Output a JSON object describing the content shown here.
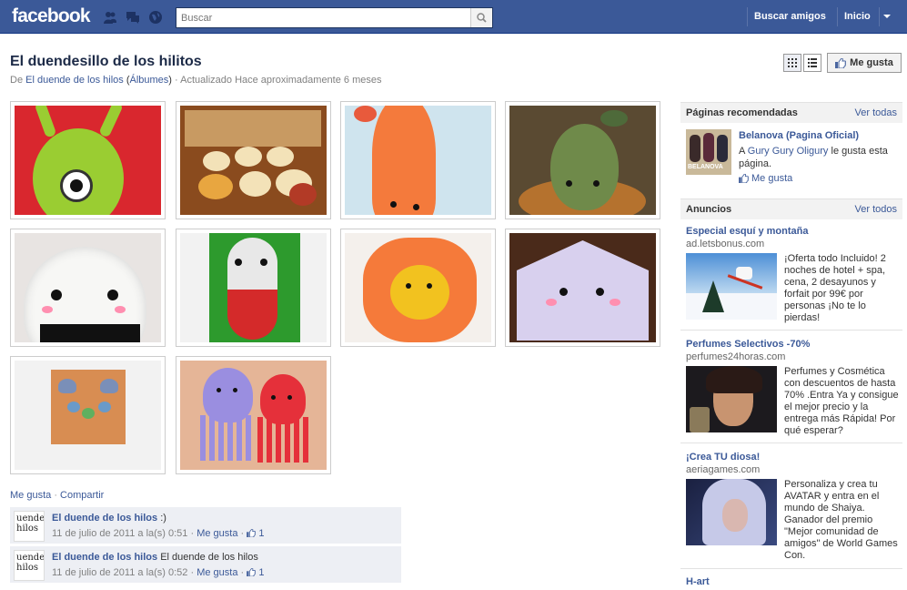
{
  "topbar": {
    "logo": "facebook",
    "search_placeholder": "Buscar",
    "find_friends": "Buscar amigos",
    "home": "Inicio"
  },
  "album": {
    "title": "El duendesillo de los hilitos",
    "meta_prefix": "De",
    "owner": "El duende de los hilos",
    "albums_open": "(",
    "albums_link": "Álbumes",
    "albums_close": ")",
    "updated": "· Actualizado Hace aproximadamente 6 meses",
    "like_button": "Me gusta"
  },
  "photos": [
    {
      "desc": "green alien amigurumi"
    },
    {
      "desc": "cookie amigurumis"
    },
    {
      "desc": "orange squid amigurumi"
    },
    {
      "desc": "green pear amigurumi"
    },
    {
      "desc": "white onigiri amigurumi"
    },
    {
      "desc": "red white capsule amigurumi"
    },
    {
      "desc": "orange flower amigurumi"
    },
    {
      "desc": "purple house amigurumi"
    },
    {
      "desc": "tiny slime figures"
    },
    {
      "desc": "purple and red octopus amigurumis"
    }
  ],
  "actions": {
    "like": "Me gusta",
    "dot": "·",
    "share": "Compartir"
  },
  "comments": [
    {
      "avatar_text": "uende\nhilos",
      "author": "El duende de los hilos",
      "text": ":)",
      "time": "11 de julio de 2011 a la(s) 0:51 ·",
      "like": "Me gusta",
      "dot": "·",
      "likes": "1"
    },
    {
      "avatar_text": "uende\nhilos",
      "author": "El duende de los hilos",
      "text": "El duende de los hilos",
      "time": "11 de julio de 2011 a la(s) 0:52 ·",
      "like": "Me gusta",
      "dot": "·",
      "likes": "1"
    }
  ],
  "sidebar": {
    "recommended": {
      "title": "Páginas recomendadas",
      "see_all": "Ver todas",
      "page_name": "Belanova (Pagina Oficial)",
      "line_prefix": "A",
      "friend": "Gury Gury Oligury",
      "line_suffix": "le gusta esta página.",
      "like": "Me gusta",
      "thumb_text": "BELANOVA"
    },
    "ads": {
      "title": "Anuncios",
      "see_all": "Ver todos",
      "items": [
        {
          "title": "Especial esquí y montaña",
          "domain": "ad.letsbonus.com",
          "text": "¡Oferta todo Incluido! 2 noches de hotel + spa, cena, 2 desayunos y forfait por 99€ por personas ¡No te lo pierdas!"
        },
        {
          "title": "Perfumes Selectivos -70%",
          "domain": "perfumes24horas.com",
          "text": "Perfumes y Cosmética con descuentos de hasta 70% .Entra Ya y consigue el mejor precio y la entrega más Rápida! Por qué esperar?"
        },
        {
          "title": "¡Crea TU diosa!",
          "domain": "aeriagames.com",
          "text": "Personaliza y crea tu AVATAR y entra en el mundo de Shaiya. Ganador del premio \"Mejor comunidad de amigos\" de World Games Con."
        },
        {
          "title": "H-art",
          "domain": "",
          "text": ""
        }
      ]
    }
  },
  "colors": {
    "brand": "#3b5998",
    "panel": "#edeff4"
  }
}
